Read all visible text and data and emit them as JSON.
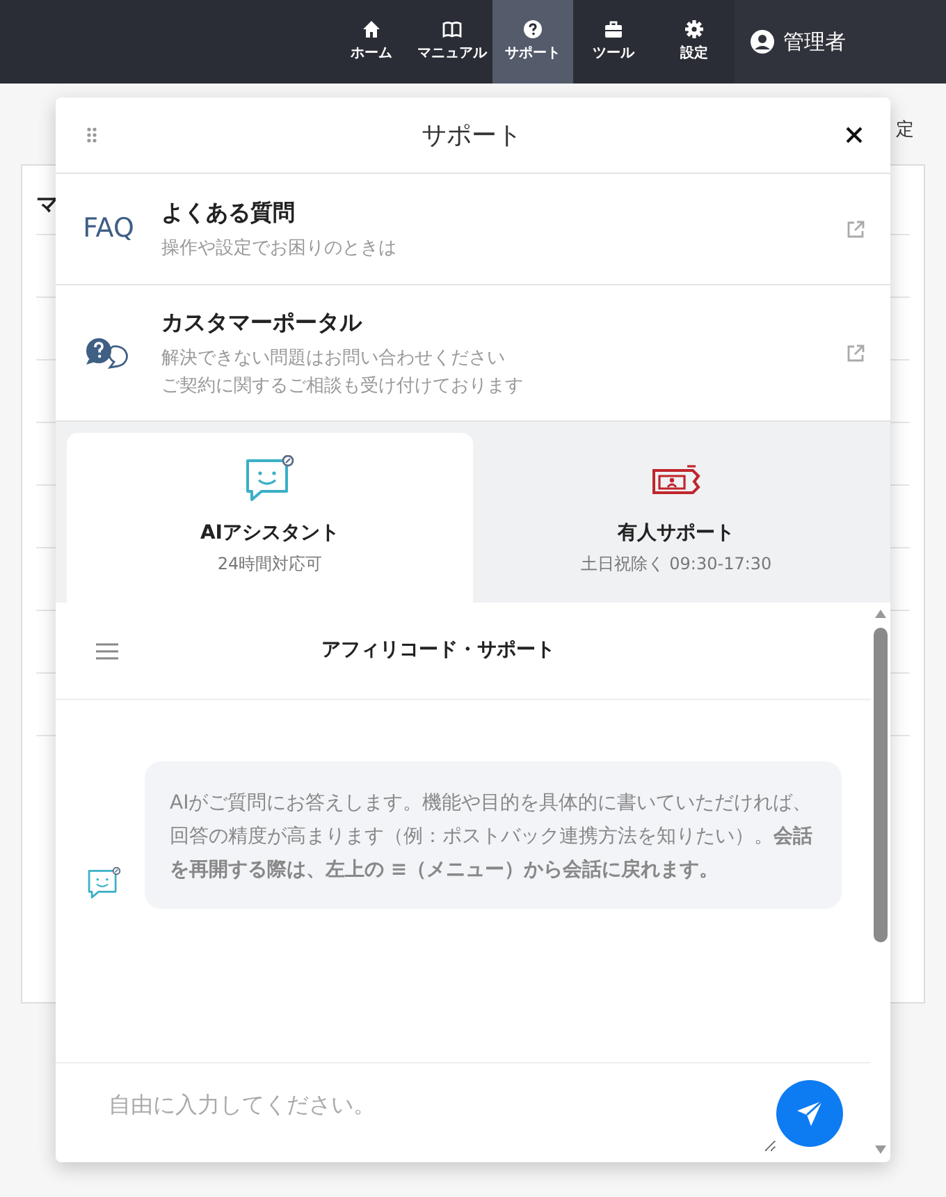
{
  "navbar": {
    "items": [
      {
        "label": "ホーム",
        "selected": false
      },
      {
        "label": "マニュアル",
        "selected": false
      },
      {
        "label": "サポート",
        "selected": true
      },
      {
        "label": "ツール",
        "selected": false
      },
      {
        "label": "設定",
        "selected": false
      }
    ],
    "user": "管理者"
  },
  "background": {
    "card_heading": "マ",
    "side_text": "定"
  },
  "panel": {
    "title": "サポート",
    "links": [
      {
        "kind": "faq",
        "icon_text": "FAQ",
        "title": "よくある質問",
        "lines": [
          "操作や設定でお困りのときは"
        ]
      },
      {
        "kind": "portal",
        "title": "カスタマーポータル",
        "lines": [
          "解決できない問題はお問い合わせください",
          "ご契約に関するご相談も受け付けております"
        ]
      }
    ],
    "tabs": [
      {
        "kind": "ai",
        "label": "AIアシスタント",
        "sub": "24時間対応可",
        "selected": true
      },
      {
        "kind": "human",
        "label": "有人サポート",
        "sub": "土日祝除く 09:30-17:30",
        "selected": false
      }
    ],
    "chat": {
      "title": "アフィリコード・サポート",
      "messages": [
        {
          "text": "AIがご質問にお答えします。機能や目的を具体的に書いていただければ、回答の精度が高まります（例：ポストバック連携方法を知りたい）。**会話を再開する際は、左上の ≡（メニュー）から会話に戻れます。**"
        }
      ],
      "input": {
        "placeholder": "自由に入力してください。"
      }
    }
  }
}
